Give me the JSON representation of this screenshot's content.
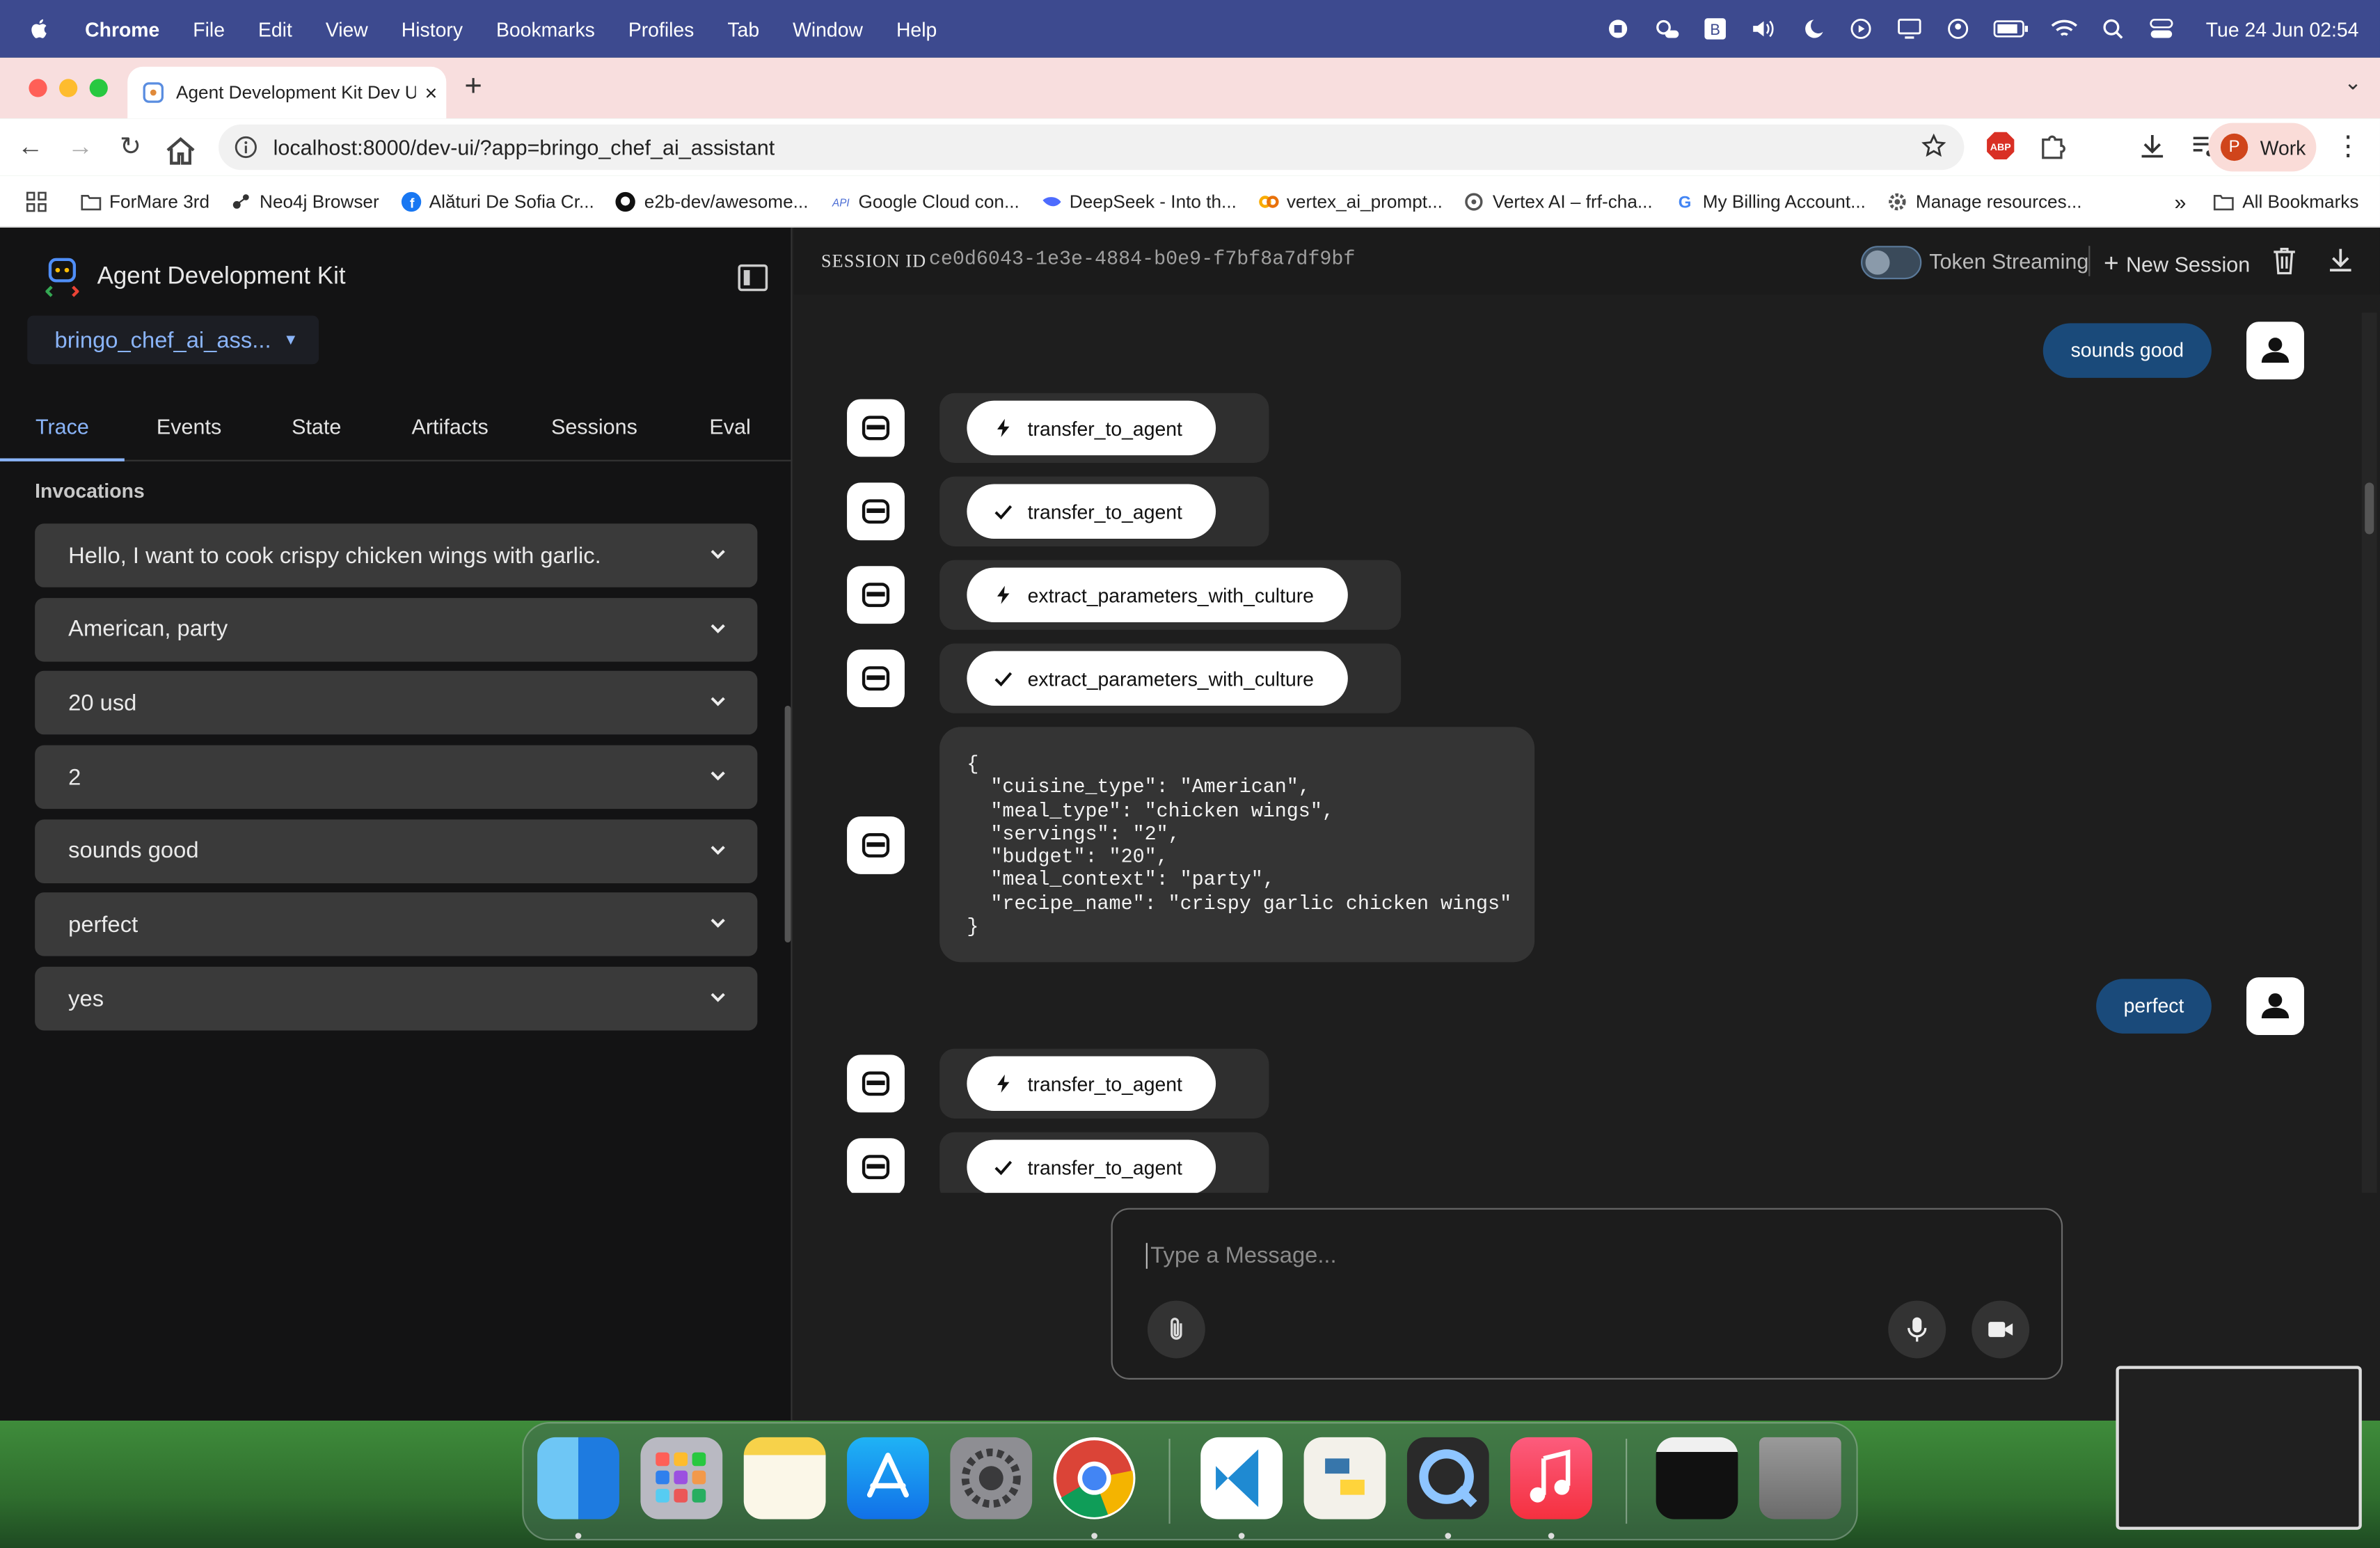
{
  "menubar": {
    "app": "Chrome",
    "menus": [
      "File",
      "Edit",
      "View",
      "History",
      "Bookmarks",
      "Profiles",
      "Tab",
      "Window",
      "Help"
    ],
    "clock": "Tue 24 Jun  02:54"
  },
  "browser": {
    "tab_title": "Agent Development Kit Dev U",
    "url": "localhost:8000/dev-ui/?app=bringo_chef_ai_assistant",
    "profile_initial": "P",
    "profile_label": "Work"
  },
  "bookmarks": [
    "ForMare 3rd",
    "Neo4j Browser",
    "Alături De Sofia Cr...",
    "e2b-dev/awesome...",
    "Google Cloud con...",
    "DeepSeek - Into th...",
    "vertex_ai_prompt...",
    "Vertex AI – frf-cha...",
    "My Billing Account...",
    "Manage resources..."
  ],
  "all_bookmarks": "All Bookmarks",
  "sidebar": {
    "title": "Agent Development Kit",
    "app_selector": "bringo_chef_ai_ass...",
    "tabs": [
      "Trace",
      "Events",
      "State",
      "Artifacts",
      "Sessions",
      "Eval"
    ],
    "active_tab": "Trace",
    "invocations_title": "Invocations",
    "invocations": [
      "Hello, I want to cook crispy chicken wings with garlic.",
      "American, party",
      "20 usd",
      "2",
      "sounds good",
      "perfect",
      "yes"
    ]
  },
  "session": {
    "label": "SESSION ID",
    "id": "ce0d6043-1e3e-4884-b0e9-f7bf8a7df9bf",
    "token_streaming_label": "Token Streaming",
    "new_session_label": "New Session"
  },
  "chat": {
    "user_msg_1": "sounds good",
    "fn_1": "transfer_to_agent",
    "fn_2": "transfer_to_agent",
    "fn_3": "extract_parameters_with_culture",
    "fn_4": "extract_parameters_with_culture",
    "json_output": "{\n  \"cuisine_type\": \"American\",\n  \"meal_type\": \"chicken wings\",\n  \"servings\": \"2\",\n  \"budget\": \"20\",\n  \"meal_context\": \"party\",\n  \"recipe_name\": \"crispy garlic chicken wings\"\n}",
    "user_msg_2": "perfect",
    "fn_5": "transfer_to_agent",
    "fn_6": "transfer_to_agent"
  },
  "composer": {
    "placeholder": "Type a Message..."
  },
  "colors": {
    "accent": "#8ab4f8",
    "user_bubble": "#1a4a7a",
    "menubar": "#3d4a8f",
    "tabstrip": "#f8dede"
  }
}
